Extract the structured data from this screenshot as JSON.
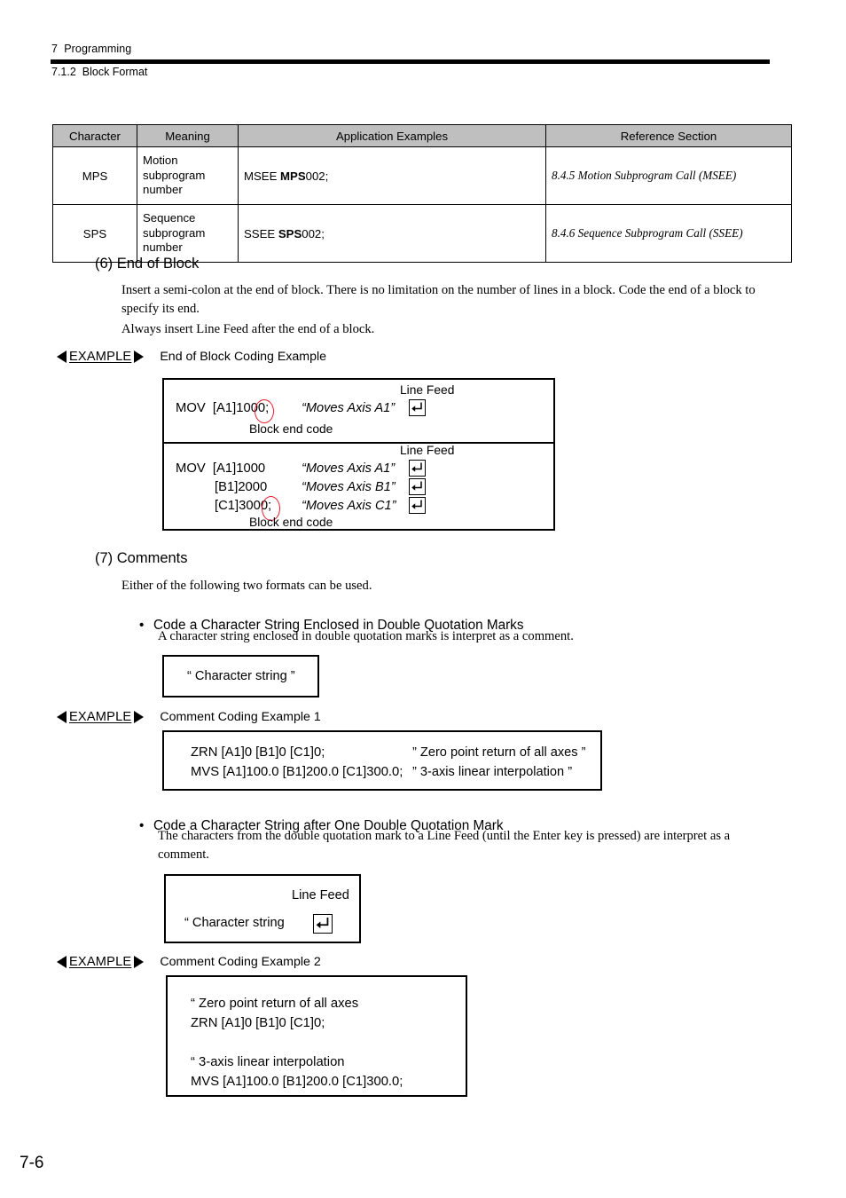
{
  "header": {
    "chapter": "7  Programming",
    "section": "7.1.2  Block Format"
  },
  "table": {
    "columns": [
      "Character",
      "Meaning",
      "Application Examples",
      "Reference Section"
    ],
    "rows": [
      {
        "character": "MPS",
        "meaning": "Motion\nsubprogram\nnumber",
        "example_prefix": "MSEE ",
        "example_bold": "MPS",
        "example_suffix": "002;",
        "reference": "8.4.5 Motion Subprogram Call (MSEE)"
      },
      {
        "character": "SPS",
        "meaning": "Sequence\nsubprogram\nnumber",
        "example_prefix": "SSEE ",
        "example_bold": "SPS",
        "example_suffix": "002;",
        "reference": "8.4.6 Sequence Subprogram Call (SSEE)"
      }
    ]
  },
  "section6": {
    "heading": "(6) End of Block",
    "para1": "Insert a semi-colon at the end of block. There is no limitation on the number of lines in a block. Code the end of a block to specify its end.",
    "para2": "Always insert Line Feed after the end of a block.",
    "example_label": "EXAMPLE",
    "example_caption": "End of Block Coding Example",
    "box": {
      "part1": {
        "line_feed_label": "Line Feed",
        "code": "MOV  [A1]1000;",
        "comment": "“Moves Axis A1”",
        "block_end_label": "Block end code"
      },
      "part2": {
        "line_feed_label": "Line Feed",
        "code_line1": "MOV  [A1]1000",
        "code_line2": "[B1]2000",
        "code_line3": "[C1]3000;",
        "comment1": "“Moves Axis A1”",
        "comment2": "“Moves Axis B1”",
        "comment3": "“Moves Axis C1”",
        "block_end_label": "Block end code"
      }
    }
  },
  "section7": {
    "heading": "(7) Comments",
    "intro": "Either of the following two formats can be used.",
    "bullet1": {
      "title": "Code a Character String Enclosed in Double Quotation Marks",
      "para": "A character string enclosed in double quotation marks is interpret as a comment.",
      "format_box_text": "“ Character string ”",
      "example_label": "EXAMPLE",
      "example_caption": "Comment Coding Example 1",
      "code_line1": "ZRN [A1]0 [B1]0 [C1]0;",
      "comment_line1": "” Zero point return of all axes ”",
      "code_line2": "MVS [A1]100.0 [B1]200.0 [C1]300.0;",
      "comment_line2": "” 3-axis linear interpolation ”"
    },
    "bullet2": {
      "title": "Code a Character String after One Double Quotation Mark",
      "para": "The characters from the double quotation mark to a Line Feed (until the Enter key is pressed) are interpret as a comment.",
      "format_box": {
        "line_feed_label": "Line Feed",
        "text": "“ Character string"
      },
      "example_label": "EXAMPLE",
      "example_caption": "Comment Coding Example 2",
      "code_line1": "“ Zero point return of all axes",
      "code_line2": "ZRN [A1]0 [B1]0 [C1]0;",
      "code_line3": "“ 3-axis linear interpolation",
      "code_line4": "MVS [A1]100.0 [B1]200.0 [C1]300.0;"
    }
  },
  "footer": {
    "page_number": "7-6"
  },
  "colors": {
    "annotation_red": "#e8192c",
    "table_header_gray": "#bfbfbf"
  }
}
